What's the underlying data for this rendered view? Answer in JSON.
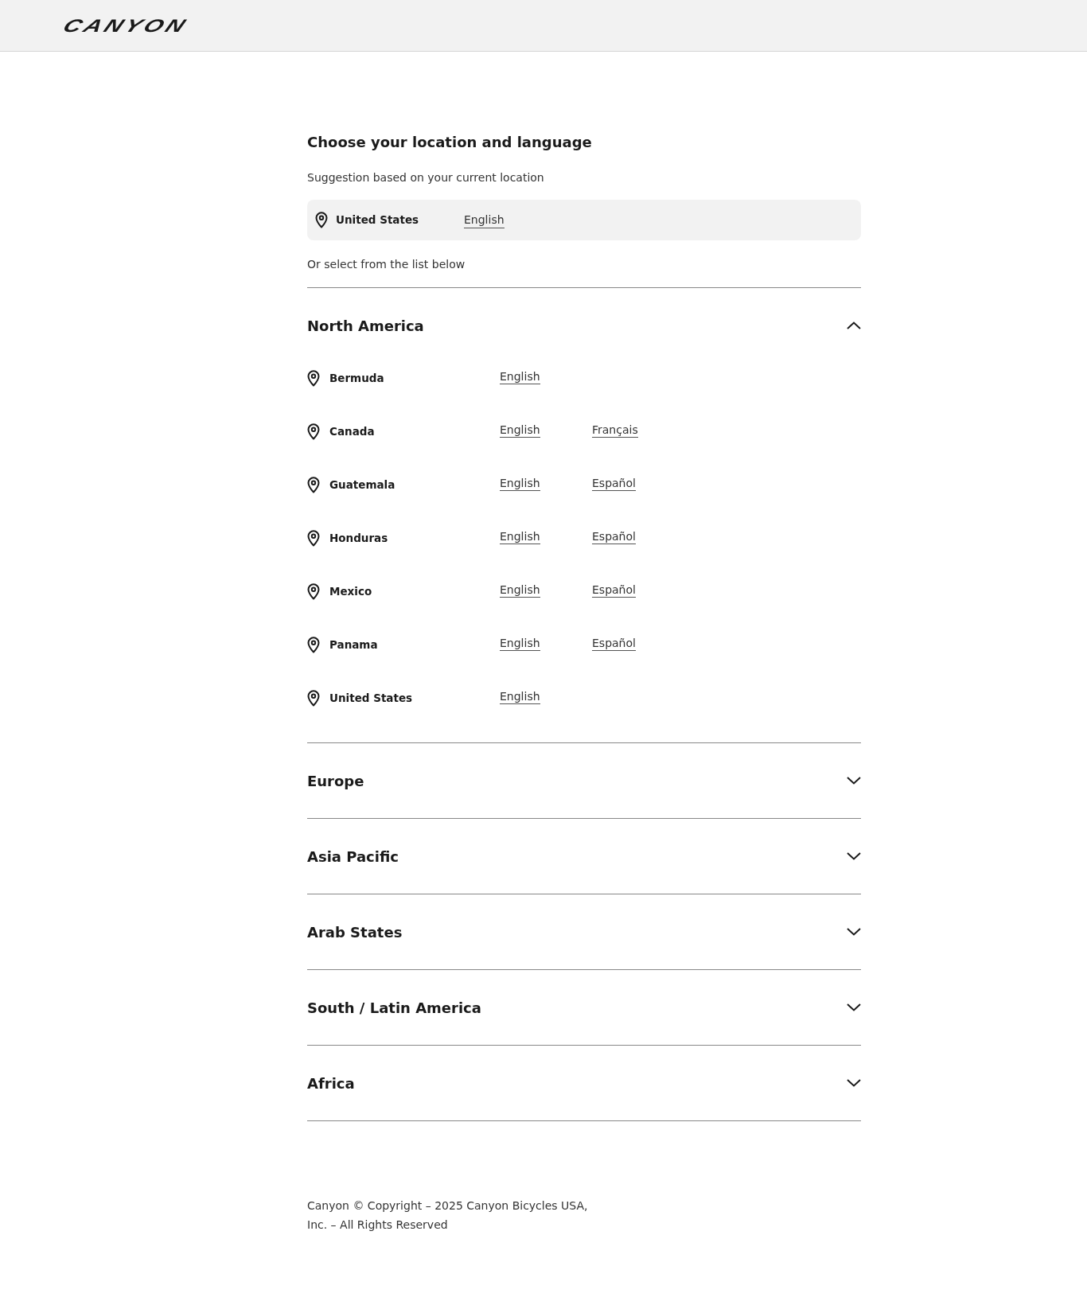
{
  "header": {
    "logo": "CANYON"
  },
  "title": "Choose your location and language",
  "suggestion_label": "Suggestion based on your current location",
  "suggestion": {
    "country": "United States",
    "languages": [
      "English"
    ]
  },
  "list_label": "Or select from the list below",
  "regions": [
    {
      "name": "North America",
      "expanded": true,
      "countries": [
        {
          "name": "Bermuda",
          "languages": [
            "English"
          ]
        },
        {
          "name": "Canada",
          "languages": [
            "English",
            "Français"
          ]
        },
        {
          "name": "Guatemala",
          "languages": [
            "English",
            "Español"
          ]
        },
        {
          "name": "Honduras",
          "languages": [
            "English",
            "Español"
          ]
        },
        {
          "name": "Mexico",
          "languages": [
            "English",
            "Español"
          ]
        },
        {
          "name": "Panama",
          "languages": [
            "English",
            "Español"
          ]
        },
        {
          "name": "United States",
          "languages": [
            "English"
          ]
        }
      ]
    },
    {
      "name": "Europe",
      "expanded": false
    },
    {
      "name": "Asia Pacific",
      "expanded": false
    },
    {
      "name": "Arab States",
      "expanded": false
    },
    {
      "name": "South / Latin America",
      "expanded": false
    },
    {
      "name": "Africa",
      "expanded": false
    }
  ],
  "footer": [
    "Canyon © Copyright – 2025 Canyon Bicycles USA,",
    "Inc. – All Rights Reserved"
  ]
}
